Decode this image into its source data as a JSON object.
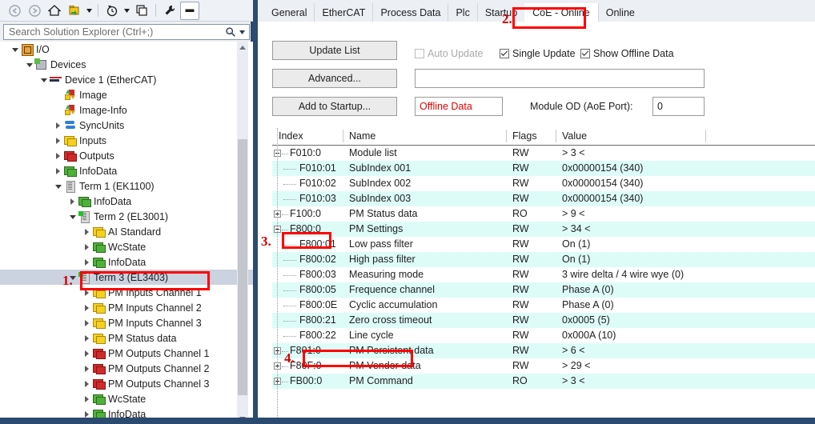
{
  "solution_explorer": {
    "toolbar": [
      {
        "name": "back-icon",
        "glyph": "◀"
      },
      {
        "name": "forward-icon",
        "glyph": "▶"
      },
      {
        "name": "home-icon",
        "glyph": "⌂"
      },
      {
        "name": "sync-with-active-document-icon",
        "glyph": "❐"
      },
      {
        "name": "pending-changes-icon",
        "glyph": "◴"
      },
      {
        "name": "show-all-files-icon",
        "glyph": "⧉"
      },
      {
        "name": "properties-icon",
        "glyph": "⚒"
      },
      {
        "name": "collapse-all-icon",
        "glyph": "▬"
      }
    ],
    "search": {
      "placeholder": "Search Solution Explorer (Ctrl+;)",
      "value": "",
      "icon": "search-icon"
    },
    "tree": [
      {
        "label": "I/O",
        "indent": 0,
        "twisty": "expanded",
        "icon": "io-icon"
      },
      {
        "label": "Devices",
        "indent": 1,
        "twisty": "expanded",
        "icon": "devices-icon"
      },
      {
        "label": "Device 1 (EtherCAT)",
        "indent": 2,
        "twisty": "expanded",
        "icon": "ethercat-device-icon"
      },
      {
        "label": "Image",
        "indent": 3,
        "twisty": "none",
        "icon": "image-icon"
      },
      {
        "label": "Image-Info",
        "indent": 3,
        "twisty": "none",
        "icon": "image-info-icon"
      },
      {
        "label": "SyncUnits",
        "indent": 3,
        "twisty": "collapsed",
        "icon": "syncunits-icon"
      },
      {
        "label": "Inputs",
        "indent": 3,
        "twisty": "collapsed",
        "icon": "inputs-icon"
      },
      {
        "label": "Outputs",
        "indent": 3,
        "twisty": "collapsed",
        "icon": "outputs-icon"
      },
      {
        "label": "InfoData",
        "indent": 3,
        "twisty": "collapsed",
        "icon": "infodata-icon"
      },
      {
        "label": "Term 1 (EK1100)",
        "indent": 3,
        "twisty": "expanded",
        "icon": "terminal-icon"
      },
      {
        "label": "InfoData",
        "indent": 4,
        "twisty": "collapsed",
        "icon": "infodata-icon"
      },
      {
        "label": "Term 2 (EL3001)",
        "indent": 4,
        "twisty": "expanded",
        "icon": "terminal-on-icon"
      },
      {
        "label": "AI Standard",
        "indent": 5,
        "twisty": "collapsed",
        "icon": "inputs-icon"
      },
      {
        "label": "WcState",
        "indent": 5,
        "twisty": "collapsed",
        "icon": "infodata-icon"
      },
      {
        "label": "InfoData",
        "indent": 5,
        "twisty": "collapsed",
        "icon": "infodata-icon"
      },
      {
        "label": "Term 3 (EL3403)",
        "indent": 4,
        "twisty": "expanded",
        "icon": "terminal-on-icon",
        "selected": true
      },
      {
        "label": "PM Inputs Channel 1",
        "indent": 5,
        "twisty": "collapsed",
        "icon": "inputs-icon"
      },
      {
        "label": "PM Inputs Channel 2",
        "indent": 5,
        "twisty": "collapsed",
        "icon": "inputs-icon"
      },
      {
        "label": "PM Inputs Channel 3",
        "indent": 5,
        "twisty": "collapsed",
        "icon": "inputs-icon"
      },
      {
        "label": "PM Status data",
        "indent": 5,
        "twisty": "collapsed",
        "icon": "inputs-icon"
      },
      {
        "label": "PM Outputs Channel 1",
        "indent": 5,
        "twisty": "collapsed",
        "icon": "outputs-icon"
      },
      {
        "label": "PM Outputs Channel 2",
        "indent": 5,
        "twisty": "collapsed",
        "icon": "outputs-icon"
      },
      {
        "label": "PM Outputs Channel 3",
        "indent": 5,
        "twisty": "collapsed",
        "icon": "outputs-icon"
      },
      {
        "label": "WcState",
        "indent": 5,
        "twisty": "collapsed",
        "icon": "infodata-icon"
      },
      {
        "label": "InfoData",
        "indent": 5,
        "twisty": "collapsed",
        "icon": "infodata-icon"
      }
    ]
  },
  "editor": {
    "tabs": [
      {
        "label": "General",
        "selected": false
      },
      {
        "label": "EtherCAT",
        "selected": false
      },
      {
        "label": "Process Data",
        "selected": false
      },
      {
        "label": "Plc",
        "selected": false
      },
      {
        "label": "Startup",
        "selected": false
      },
      {
        "label": "CoE - Online",
        "selected": true
      },
      {
        "label": "Online",
        "selected": false
      }
    ],
    "buttons": {
      "update_list": "Update List",
      "advanced": "Advanced...",
      "add_to_startup": "Add to Startup..."
    },
    "checkboxes": [
      {
        "label": "Auto Update",
        "checked": false,
        "disabled": true
      },
      {
        "label": "Single Update",
        "checked": true,
        "disabled": false
      },
      {
        "label": "Show Offline Data",
        "checked": true,
        "disabled": false
      }
    ],
    "filter_field": {
      "value": "",
      "placeholder": ""
    },
    "offline_data_field": {
      "value": "Offline Data"
    },
    "module_od_label": "Module OD (AoE Port):",
    "module_od_value": "0",
    "grid": {
      "columns": [
        "Index",
        "Name",
        "Flags",
        "Value"
      ],
      "rows": [
        {
          "index": "F010:0",
          "name": "Module list",
          "flags": "RW",
          "value": "> 3 <",
          "expander": "minus",
          "level": 0,
          "alt": false
        },
        {
          "index": "F010:01",
          "name": "SubIndex 001",
          "flags": "RW",
          "value": "0x00000154 (340)",
          "expander": "none",
          "level": 1,
          "alt": true
        },
        {
          "index": "F010:02",
          "name": "SubIndex 002",
          "flags": "RW",
          "value": "0x00000154 (340)",
          "expander": "none",
          "level": 1,
          "alt": false
        },
        {
          "index": "F010:03",
          "name": "SubIndex 003",
          "flags": "RW",
          "value": "0x00000154 (340)",
          "expander": "none",
          "level": 1,
          "alt": true
        },
        {
          "index": "F100:0",
          "name": "PM Status data",
          "flags": "RO",
          "value": "> 9 <",
          "expander": "plus",
          "level": 0,
          "alt": false
        },
        {
          "index": "F800:0",
          "name": "PM Settings",
          "flags": "RW",
          "value": "> 34 <",
          "expander": "minus",
          "level": 0,
          "alt": true
        },
        {
          "index": "F800:01",
          "name": "Low pass filter",
          "flags": "RW",
          "value": "On (1)",
          "expander": "none",
          "level": 1,
          "alt": false
        },
        {
          "index": "F800:02",
          "name": "High pass filter",
          "flags": "RW",
          "value": "On (1)",
          "expander": "none",
          "level": 1,
          "alt": true
        },
        {
          "index": "F800:03",
          "name": "Measuring mode",
          "flags": "RW",
          "value": "3 wire delta / 4 wire wye (0)",
          "expander": "none",
          "level": 1,
          "alt": false
        },
        {
          "index": "F800:05",
          "name": "Frequence channel",
          "flags": "RW",
          "value": "Phase A (0)",
          "expander": "none",
          "level": 1,
          "alt": true
        },
        {
          "index": "F800:0E",
          "name": "Cyclic accumulation",
          "flags": "RW",
          "value": "Phase A (0)",
          "expander": "none",
          "level": 1,
          "alt": false
        },
        {
          "index": "F800:21",
          "name": "Zero cross timeout",
          "flags": "RW",
          "value": "0x0005 (5)",
          "expander": "none",
          "level": 1,
          "alt": true
        },
        {
          "index": "F800:22",
          "name": "Line cycle",
          "flags": "RW",
          "value": "0x000A (10)",
          "expander": "none",
          "level": 1,
          "alt": false
        },
        {
          "index": "F801:0",
          "name": "PM Persistent data",
          "flags": "RW",
          "value": "> 6 <",
          "expander": "plus",
          "level": 0,
          "alt": true
        },
        {
          "index": "F80F:0",
          "name": "PM Vendor data",
          "flags": "RW",
          "value": "> 29 <",
          "expander": "plus",
          "level": 0,
          "alt": false
        },
        {
          "index": "FB00:0",
          "name": "PM Command",
          "flags": "RO",
          "value": "> 3 <",
          "expander": "plus",
          "level": 0,
          "alt": true
        }
      ]
    }
  },
  "annotations": [
    {
      "num": "1.",
      "target": "tree-item-term-3"
    },
    {
      "num": "2.",
      "target": "tab-coe-online"
    },
    {
      "num": "3.",
      "target": "grid-row-f800-0-index"
    },
    {
      "num": "4.",
      "target": "grid-row-f800-22-index"
    }
  ],
  "colors": {
    "annotation_red": "#ff0000",
    "offline_data_red": "#e60000",
    "row_alt": "#ddfcf8",
    "selection": "#cbd2e0",
    "chrome": "#2b4a6f"
  }
}
